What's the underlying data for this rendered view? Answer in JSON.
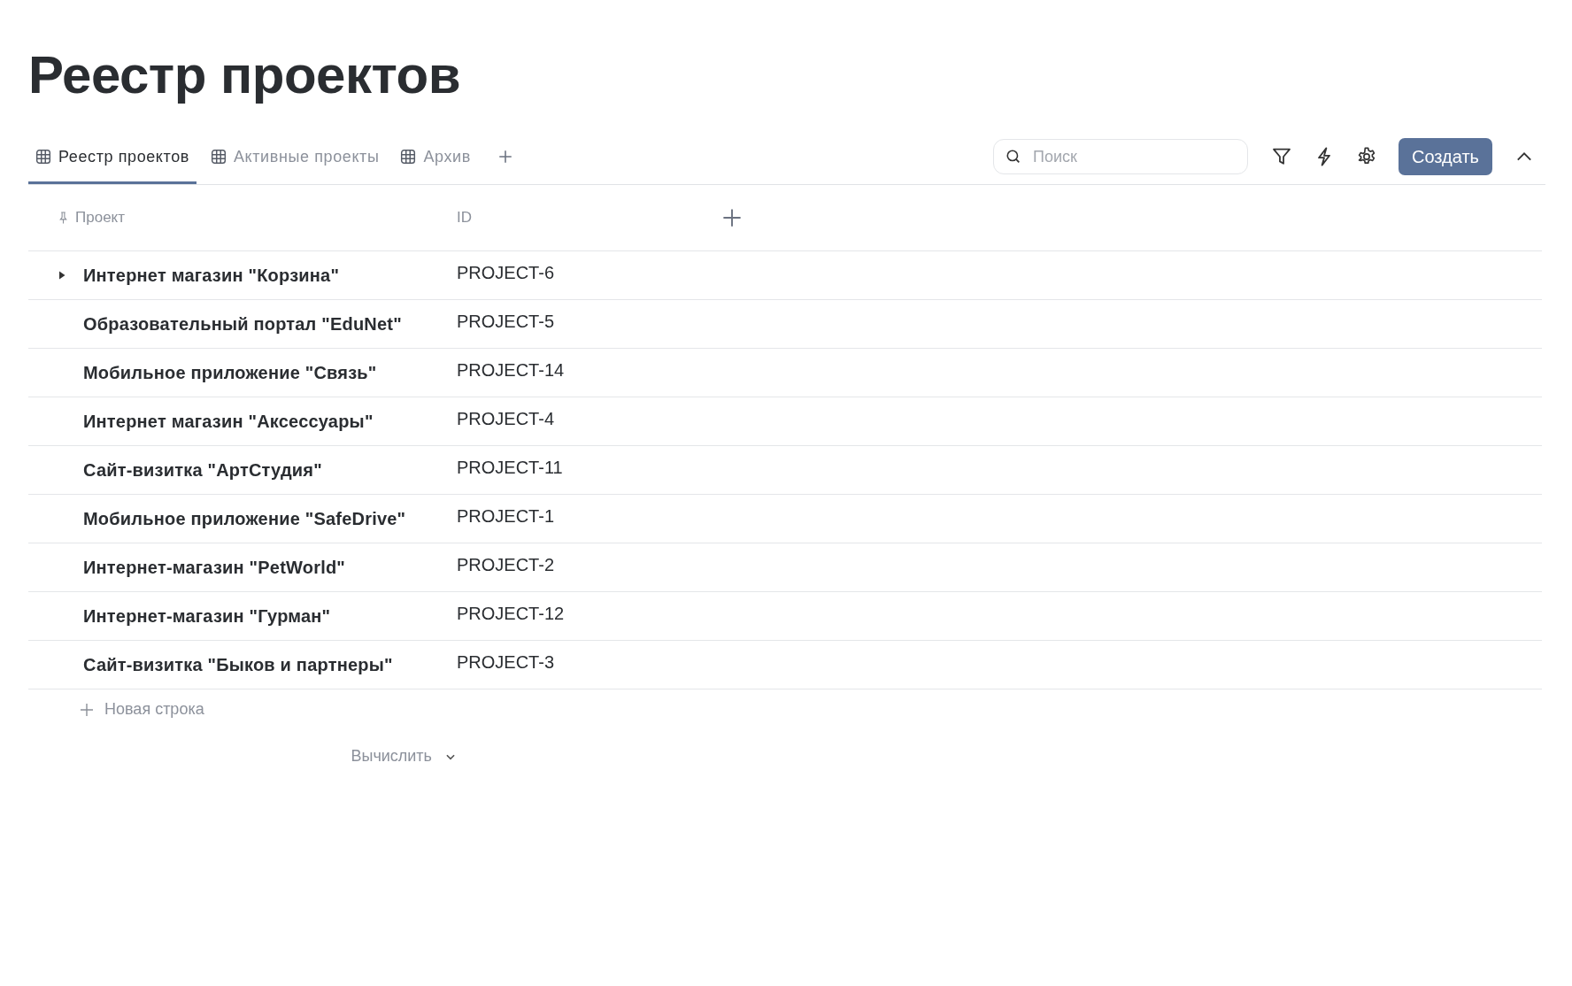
{
  "page_title": "Реестр проектов",
  "tabs": [
    {
      "label": "Реестр проектов",
      "selected": true
    },
    {
      "label": "Активные проекты",
      "selected": false
    },
    {
      "label": "Архив",
      "selected": false
    }
  ],
  "search": {
    "placeholder": "Поиск"
  },
  "create_button": "Создать",
  "table": {
    "columns": [
      "Проект",
      "ID"
    ],
    "rows": [
      {
        "project": "Интернет магазин \"Корзина\"",
        "id": "PROJECT-6",
        "expandable": true
      },
      {
        "project": "Образовательный портал \"EduNet\"",
        "id": "PROJECT-5",
        "expandable": false
      },
      {
        "project": "Мобильное приложение \"Связь\"",
        "id": "PROJECT-14",
        "expandable": false
      },
      {
        "project": "Интернет магазин \"Аксессуары\"",
        "id": "PROJECT-4",
        "expandable": false
      },
      {
        "project": "Сайт-визитка \"АртСтудия\"",
        "id": "PROJECT-11",
        "expandable": false
      },
      {
        "project": "Мобильное приложение \"SafeDrive\"",
        "id": "PROJECT-1",
        "expandable": false
      },
      {
        "project": "Интернет-магазин \"PetWorld\"",
        "id": "PROJECT-2",
        "expandable": false
      },
      {
        "project": "Интернет-магазин \"Гурман\"",
        "id": "PROJECT-12",
        "expandable": false
      },
      {
        "project": "Сайт-визитка \"Быков и партнеры\"",
        "id": "PROJECT-3",
        "expandable": false
      }
    ],
    "new_row": "Новая строка",
    "calculate": "Вычислить"
  }
}
